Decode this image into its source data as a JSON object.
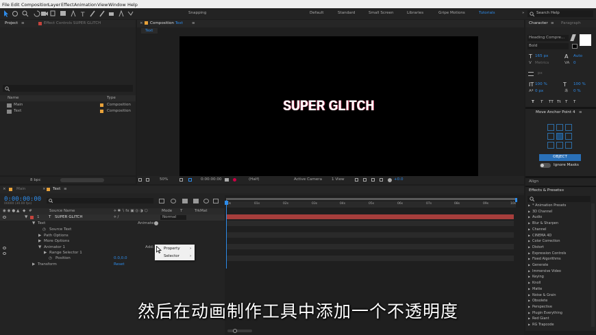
{
  "menu": [
    "File",
    "Edit",
    "Composition",
    "Layer",
    "Effect",
    "Animation",
    "View",
    "Window",
    "Help"
  ],
  "toolbar": {
    "snapping": "Snapping",
    "workspaces": [
      "Default",
      "Standard",
      "Small Screen",
      "Libraries",
      "Gripe Motions",
      "Tutorials"
    ],
    "search": "Search Help"
  },
  "project": {
    "tab": "Project",
    "effect_tab": "Effect Controls SUPER GLITCH",
    "col_name": "Name",
    "col_type": "Type",
    "items": [
      {
        "name": "Main",
        "type": "Composition"
      },
      {
        "name": "Text",
        "type": "Composition"
      }
    ]
  },
  "comp": {
    "tab_prefix": "Composition",
    "tab_name": "Text",
    "subtab": "Text",
    "canvas_text": "SUPER GLITCH",
    "zoom": "50%",
    "time": "0:00:00:00",
    "resolution": "(Half)",
    "camera": "Active Camera",
    "view": "1 View",
    "exposure": "+0.0"
  },
  "character": {
    "tab": "Character",
    "tab2": "Paragraph",
    "font": "Heading Compre...",
    "style": "Bold",
    "size": "165 px",
    "leading": "Auto",
    "tracking_label": "Metrics",
    "tracking": "0",
    "stroke": "px",
    "vscale": "100 %",
    "hscale": "100 %",
    "baseline": "0 px",
    "tsume": "0 %",
    "styles": [
      "T",
      "T",
      "TT",
      "Tt",
      "T",
      "T",
      "T"
    ]
  },
  "anchor": {
    "title": "Move Anchor Point 4",
    "button": "OBJECT",
    "ignore": "Ignore Masks"
  },
  "align": {
    "tab": "Align"
  },
  "effects": {
    "tab": "Effects & Presets",
    "items": [
      "* Animation Presets",
      "3D Channel",
      "Audio",
      "Blur & Sharpen",
      "Channel",
      "CINEMA 4D",
      "Color Correction",
      "Distort",
      "Expression Controls",
      "Fixed Algorithms",
      "Generate",
      "Immersive Video",
      "Keying",
      "Knoll",
      "Matte",
      "Noise & Grain",
      "Obsolete",
      "Perspective",
      "Plugin Everything",
      "Red Giant",
      "RG Trapcode"
    ]
  },
  "bit_depth": "8 bpc",
  "timeline": {
    "tabs": [
      "Main",
      "Text"
    ],
    "timecode": "0:00:00:00",
    "fps": "00000 (30.00 fps)",
    "col_source": "Source Name",
    "col_mode": "Mode",
    "col_trkmat": "TrkMat",
    "layer": {
      "num": "1",
      "name": "SUPER GLITCH",
      "mode": "Normal"
    },
    "rows": [
      "Text",
      "Source Text",
      "Path Options",
      "More Options",
      "Animator 1",
      "Range Selector 1",
      "Position",
      "Transform"
    ],
    "animate": "Animate:",
    "add": "Add:",
    "position_value": "0.0,0.0",
    "reset": "Reset",
    "ruler": [
      "0s",
      "01s",
      "02s",
      "03s",
      "04s",
      "05s",
      "06s",
      "07s",
      "08s",
      "09s",
      "10s"
    ]
  },
  "context_menu": [
    "Property",
    "Selector"
  ],
  "subtitle": "然后在动画制作工具中添加一个不透明度"
}
